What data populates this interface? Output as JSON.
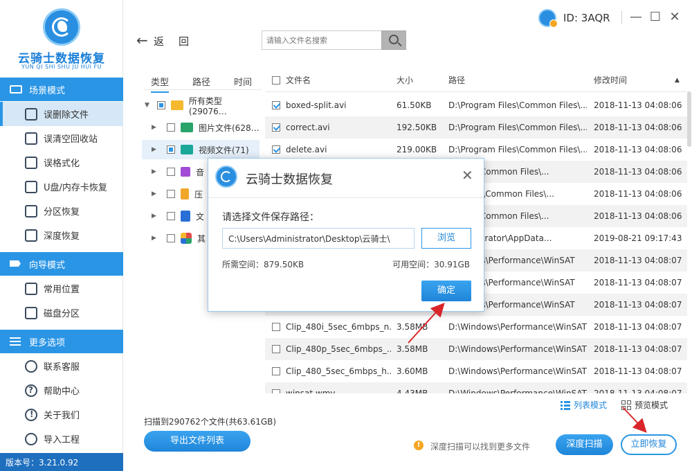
{
  "app": {
    "logo_title": "云骑士数据恢复",
    "logo_subtitle": "YUN QI SHI SHU JU HUI FU",
    "user_id": "ID: 3AQR",
    "version": "版本号：3.21.0.92"
  },
  "sidebar": {
    "sections": [
      {
        "title": "场景模式",
        "items": [
          "误删除文件",
          "误清空回收站",
          "误格式化",
          "U盘/内存卡恢复",
          "分区恢复",
          "深度恢复"
        ]
      },
      {
        "title": "向导模式",
        "items": [
          "常用位置",
          "磁盘分区"
        ]
      },
      {
        "title": "更多选项",
        "items": [
          "联系客服",
          "帮助中心",
          "关于我们",
          "导入工程"
        ]
      }
    ],
    "active_item": "误删除文件"
  },
  "toolbar": {
    "back_label": "返",
    "up_label": "回",
    "search_placeholder": "请输入文件名搜索"
  },
  "tree": {
    "tabs": [
      "类型",
      "路径",
      "时间"
    ],
    "active_tab": "类型",
    "rows": [
      {
        "label": "所有类型(29076…",
        "icon": "folder-icon",
        "color": "#f5b82e"
      },
      {
        "label": "图片文件(628…",
        "icon": "image-icon",
        "color": "#2aa36b"
      },
      {
        "label": "视频文件(71)",
        "icon": "video-icon",
        "color": "#1aa89a"
      },
      {
        "label": "音",
        "icon": "music-icon",
        "color": "#a24bd6"
      },
      {
        "label": "压",
        "icon": "archive-icon",
        "color": "#f0a72a"
      },
      {
        "label": "文",
        "icon": "document-icon",
        "color": "#2a6fd6"
      },
      {
        "label": "其",
        "icon": "other-icon",
        "color": "#e24b4b"
      }
    ]
  },
  "table": {
    "columns": {
      "name": "文件名",
      "size": "大小",
      "path": "路径",
      "modified": "修改时间"
    },
    "rows": [
      {
        "checked": true,
        "name": "boxed-split.avi",
        "size": "61.50KB",
        "path": "D:\\Program Files\\Common Files\\...",
        "modified": "2018-11-13 04:08:06"
      },
      {
        "checked": true,
        "name": "correct.avi",
        "size": "192.50KB",
        "path": "D:\\Program Files\\Common Files\\...",
        "modified": "2018-11-13 04:08:06"
      },
      {
        "checked": true,
        "name": "delete.avi",
        "size": "219.00KB",
        "path": "D:\\Program Files\\Common Files\\...",
        "modified": "2018-11-13 04:08:06"
      },
      {
        "checked": false,
        "name": "",
        "size": "",
        "path": "m Files\\Common Files\\...",
        "modified": "2018-11-13 04:08:06"
      },
      {
        "checked": false,
        "name": "",
        "size": "",
        "path": "am Files\\Common Files\\...",
        "modified": "2018-11-13 04:08:06"
      },
      {
        "checked": false,
        "name": "",
        "size": "",
        "path": "m Files\\Common Files\\...",
        "modified": "2018-11-13 04:08:06"
      },
      {
        "checked": false,
        "name": "",
        "size": "",
        "path": "Administrator\\AppData...",
        "modified": "2019-08-21 09:17:43"
      },
      {
        "checked": false,
        "name": "",
        "size": "",
        "path": "Windows\\Performance\\WinSAT",
        "modified": "2018-11-13 04:08:07"
      },
      {
        "checked": false,
        "name": "",
        "size": "",
        "path": "Windows\\Performance\\WinSAT",
        "modified": "2018-11-13 04:08:07"
      },
      {
        "checked": false,
        "name": "",
        "size": "",
        "path": "Windows\\Performance\\WinSAT",
        "modified": "2018-11-13 04:08:07"
      },
      {
        "checked": false,
        "name": "Clip_480i_5sec_6mbps_n...",
        "size": "3.58MB",
        "path": "D:\\Windows\\Performance\\WinSAT",
        "modified": "2018-11-13 04:08:07"
      },
      {
        "checked": false,
        "name": "Clip_480p_5sec_6mbps_...",
        "size": "3.58MB",
        "path": "D:\\Windows\\Performance\\WinSAT",
        "modified": "2018-11-13 04:08:07"
      },
      {
        "checked": false,
        "name": "Clip_480_5sec_6mbps_h...",
        "size": "3.60MB",
        "path": "D:\\Windows\\Performance\\WinSAT",
        "modified": "2018-11-13 04:08:07"
      },
      {
        "checked": false,
        "name": "winsat.wmv",
        "size": "4.43MB",
        "path": "D:\\Windows\\Performance\\WinSAT",
        "modified": "2018-11-13 04:08:07"
      }
    ]
  },
  "bottom": {
    "list_mode": "列表模式",
    "preview_mode": "预览模式",
    "scan_info": "扫描到290762个文件(共63.61GB)",
    "export_button": "导出文件列表",
    "tip": "深度扫描可以找到更多文件",
    "deep_scan_button": "深度扫描",
    "recover_button": "立即恢复"
  },
  "dialog": {
    "title": "云骑士数据恢复",
    "prompt": "请选择文件保存路径：",
    "path_value": "C:\\Users\\Administrator\\Desktop\\云骑士\\",
    "browse_button": "浏览",
    "required_space": "所需空间：879.50KB",
    "available_space": "可用空间：30.91GB",
    "ok_button": "确定"
  },
  "colors": {
    "accent": "#2a95e5",
    "annotation_arrow": "#d9262b"
  }
}
